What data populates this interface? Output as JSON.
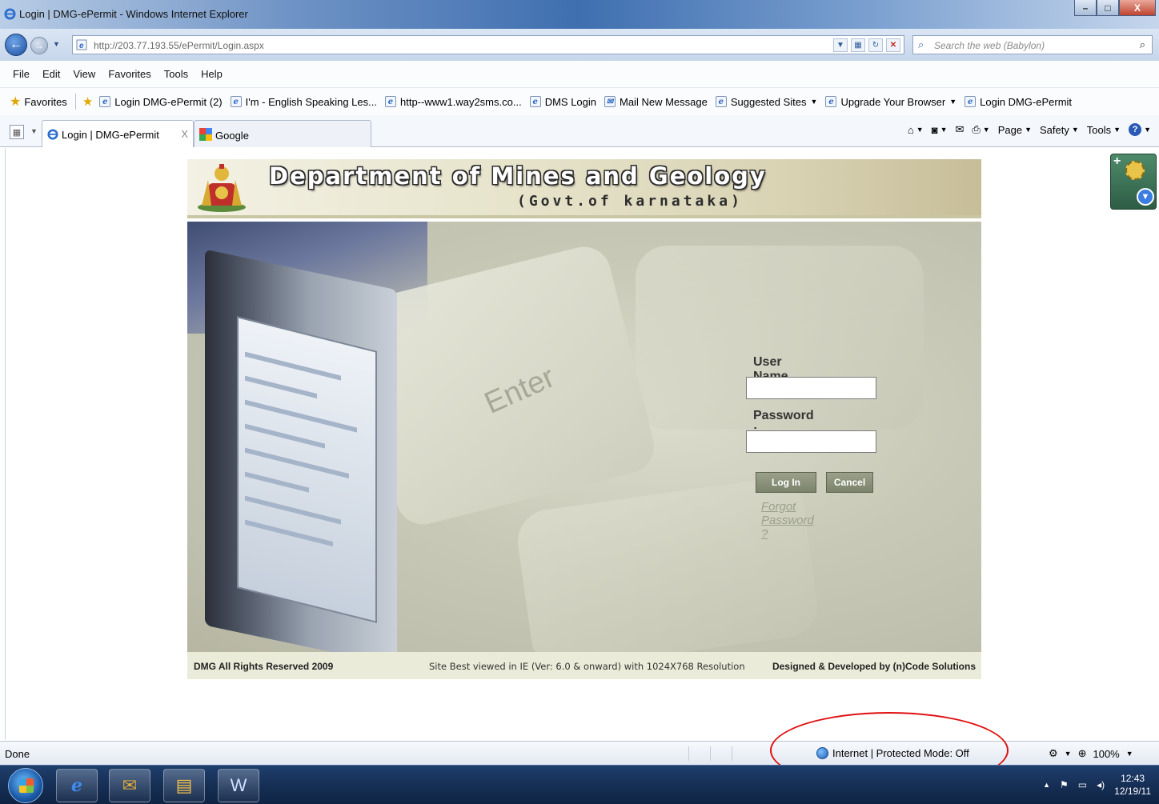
{
  "window": {
    "title": "Login | DMG-ePermit - Windows Internet Explorer",
    "controls": {
      "minimize": "–",
      "maximize": "□",
      "close": "X"
    }
  },
  "address_bar": {
    "url": "http://203.77.193.55/ePermit/Login.aspx",
    "search_placeholder": "Search the web (Babylon)"
  },
  "menu": [
    "File",
    "Edit",
    "View",
    "Favorites",
    "Tools",
    "Help"
  ],
  "favorites_bar": {
    "label": "Favorites",
    "items": [
      {
        "label": "Login DMG-ePermit (2)",
        "dropdown": false
      },
      {
        "label": "I'm - English Speaking Les...",
        "dropdown": false
      },
      {
        "label": "http--www1.way2sms.co...",
        "dropdown": false
      },
      {
        "label": "DMS Login",
        "dropdown": false
      },
      {
        "label": "Mail New Message",
        "dropdown": false
      },
      {
        "label": "Suggested Sites",
        "dropdown": true
      },
      {
        "label": "Upgrade Your Browser",
        "dropdown": true
      },
      {
        "label": "Login DMG-ePermit",
        "dropdown": false
      }
    ]
  },
  "tabs": {
    "active": "Login | DMG-ePermit",
    "active_close": "X",
    "other": "Google"
  },
  "command_bar": {
    "page": "Page",
    "safety": "Safety",
    "tools": "Tools",
    "help": "?"
  },
  "site": {
    "title": "Department of Mines and Geology",
    "subtitle": "(Govt.of karnataka)",
    "hero_key_text": "Enter",
    "login": {
      "username_label": "User Name :",
      "username_value": "",
      "password_label": "Password :",
      "password_value": "",
      "login_button": "Log In",
      "cancel_button": "Cancel",
      "forgot_link": "Forgot Password ?"
    },
    "footer": {
      "left": "DMG All Rights Reserved 2009",
      "middle": "Site Best viewed in IE (Ver: 6.0 & onward) with 1024X768 Resolution",
      "right": "Designed & Developed by (n)Code Solutions"
    }
  },
  "status_bar": {
    "status": "Done",
    "zone": "Internet | Protected Mode: Off",
    "zoom": "100%"
  },
  "taskbar": {
    "time": "12:43",
    "date": "12/19/11"
  },
  "colors": {
    "annotation_circle": "#e01010",
    "login_button": "#8a9079",
    "header_band": "#e7e4cc"
  }
}
